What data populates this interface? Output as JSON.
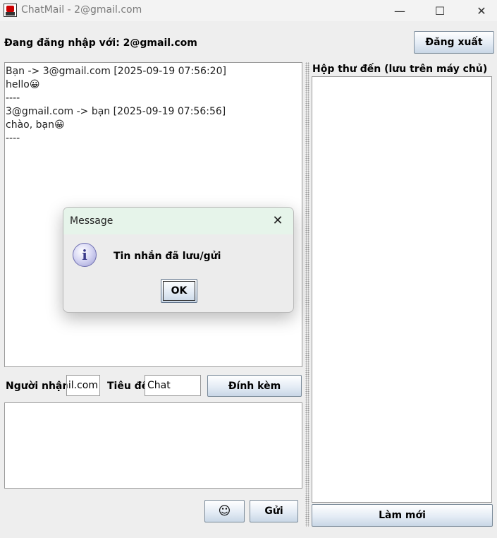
{
  "window": {
    "title": "ChatMail - 2@gmail.com",
    "minimize_glyph": "—",
    "maximize_glyph": "☐",
    "close_glyph": "✕"
  },
  "header": {
    "login_label": "Đang đăng nhập với: 2@gmail.com",
    "logout_button": "Đăng xuất"
  },
  "chat": {
    "history": "Bạn -> 3@gmail.com [2025-09-19 07:56:20]\nhello😀\n----\n3@gmail.com -> bạn [2025-09-19 07:56:56]\nchào, bạn😀\n----"
  },
  "compose": {
    "recipient_label": "Người nhận",
    "recipient_value": "ail.com",
    "subject_label": "Tiêu đề",
    "subject_value": "Chat",
    "attach_button": "Đính kèm",
    "body_value": "",
    "emoji_button": "☺",
    "send_button": "Gửi"
  },
  "inbox": {
    "header": "Hộp thư đến (lưu trên máy chủ)",
    "refresh_button": "Làm mới"
  },
  "dialog": {
    "title": "Message",
    "close_glyph": "✕",
    "icon_glyph": "i",
    "message": "Tin nhắn đã lưu/gửi",
    "ok_button": "OK"
  }
}
